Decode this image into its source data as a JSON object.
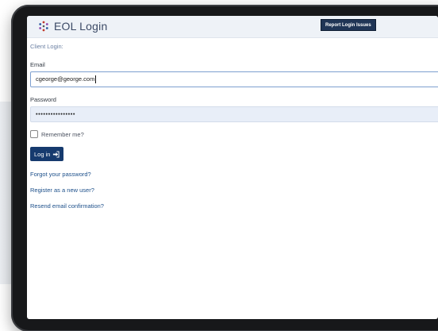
{
  "header": {
    "title": "EOL Login",
    "report_label": "Report Login Issues",
    "logo_icon": "eol-logo-icon"
  },
  "form": {
    "section_label": "Client Login:",
    "email_label": "Email",
    "email_value": "cgeorge@george.com",
    "password_label": "Password",
    "password_value": "••••••••••••••••",
    "remember_label": "Remember me?",
    "remember_checked": false,
    "login_label": "Log in",
    "login_icon": "sign-in-icon"
  },
  "links": {
    "forgot": "Forgot your password?",
    "register": "Register as a new user?",
    "resend": "Resend email confirmation?"
  },
  "colors": {
    "header_bg": "#eef2f7",
    "report_button_bg": "#1f3556",
    "login_button_bg": "#163a6e",
    "link": "#1c4f8a",
    "password_bg": "#e8eef8"
  }
}
